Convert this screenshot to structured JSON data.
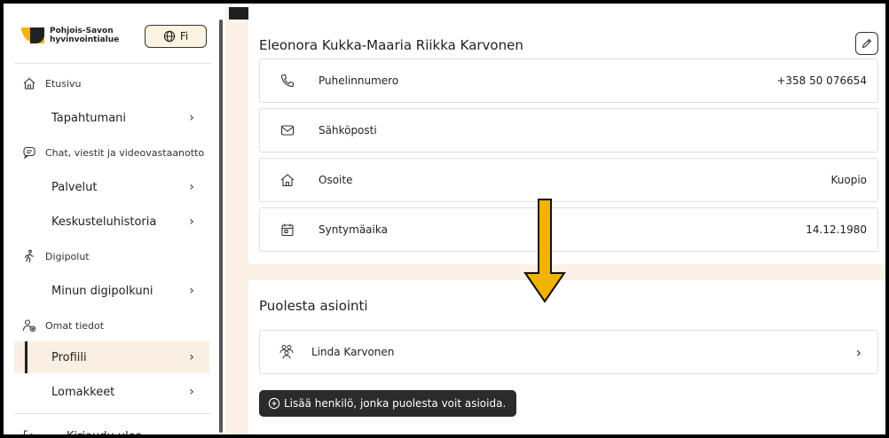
{
  "sidebar": {
    "logo_line1": "Pohjois-Savon",
    "logo_line2": "hyvinvointialue",
    "lang_label": "Fi",
    "items": [
      {
        "label": "Etusivu",
        "type": "section",
        "icon": "home-icon"
      },
      {
        "label": "Tapahtumani",
        "type": "sub",
        "chevron": "›"
      },
      {
        "label": "Chat, viestit ja videovastaanotto",
        "type": "section",
        "icon": "chat-icon"
      },
      {
        "label": "Palvelut",
        "type": "sub",
        "chevron": "›"
      },
      {
        "label": "Keskusteluhistoria",
        "type": "sub",
        "chevron": "›"
      },
      {
        "label": "Digipolut",
        "type": "section",
        "icon": "walking-icon"
      },
      {
        "label": "Minun digipolkuni",
        "type": "sub",
        "chevron": "›"
      },
      {
        "label": "Omat tiedot",
        "type": "section",
        "icon": "user-settings-icon"
      },
      {
        "label": "Profiili",
        "type": "sub",
        "chevron": "›",
        "active": true
      },
      {
        "label": "Lomakkeet",
        "type": "sub",
        "chevron": "›"
      },
      {
        "label": "Kirjaudu ulos",
        "type": "sub",
        "icon": "logout-icon"
      }
    ]
  },
  "profile": {
    "name": "Eleonora Kukka-Maaria Riikka Karvonen",
    "rows": [
      {
        "label": "Puhelinnumero",
        "value": "+358 50 076654",
        "icon": "phone-icon"
      },
      {
        "label": "Sähköposti",
        "value": "",
        "icon": "mail-icon"
      },
      {
        "label": "Osoite",
        "value": "Kuopio",
        "icon": "home-icon"
      },
      {
        "label": "Syntymäaika",
        "value": "14.12.1980",
        "icon": "calendar-icon"
      }
    ]
  },
  "proxy": {
    "title": "Puolesta asiointi",
    "person": "Linda Karvonen",
    "add_label": "Lisää henkilö, jonka puolesta voit asioida."
  },
  "colors": {
    "accent": "#f0b400",
    "main_bg": "#fbf1e7",
    "active_bg": "#fbeee2",
    "tooltip_bg": "#2b2b2b"
  }
}
